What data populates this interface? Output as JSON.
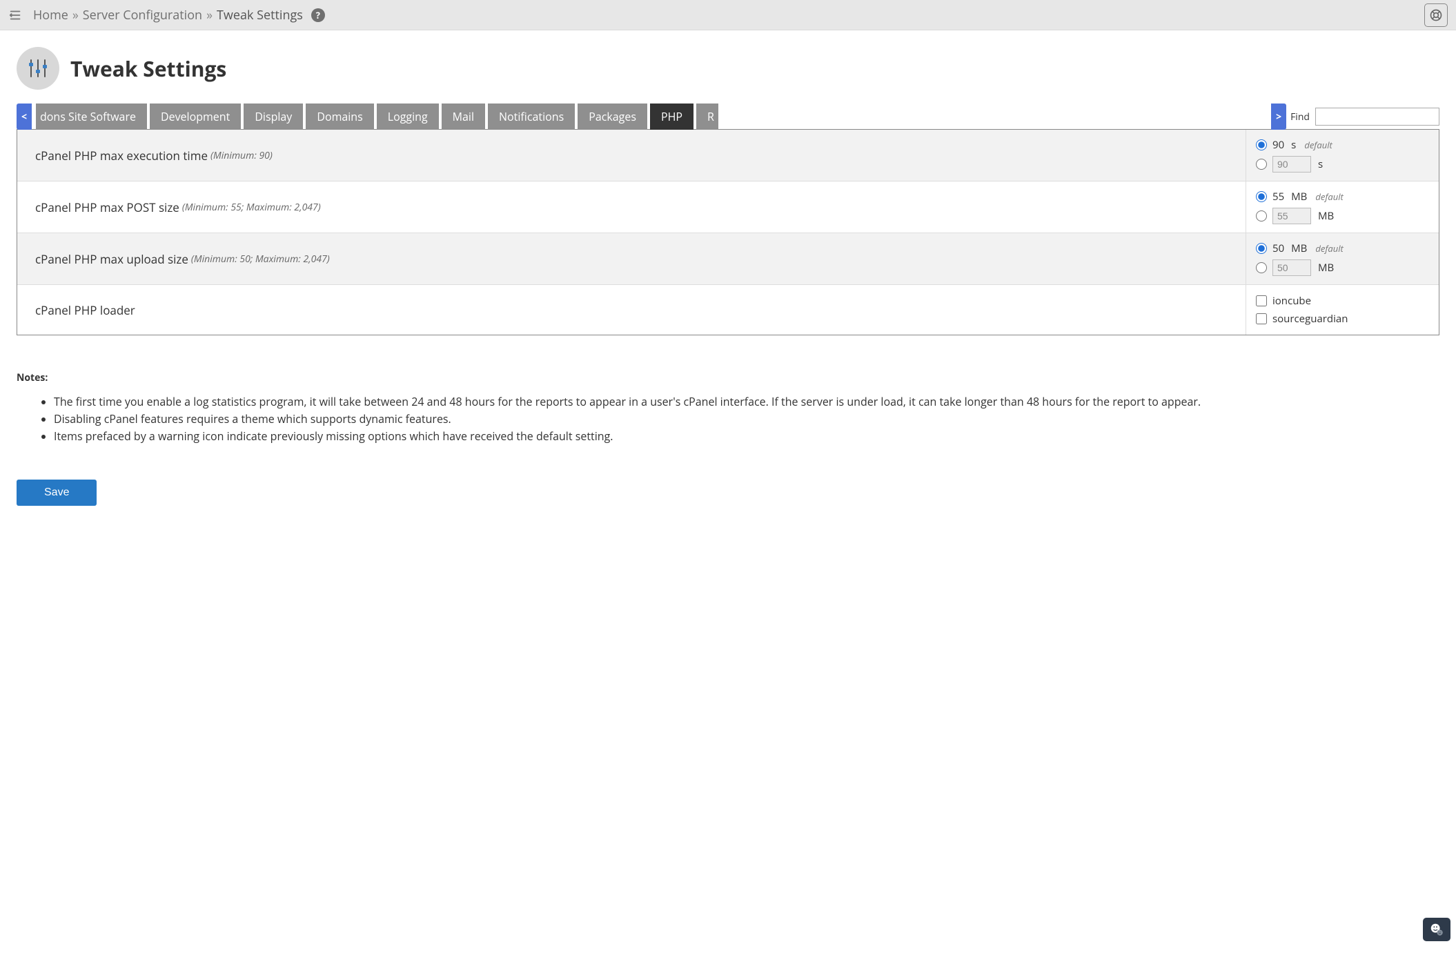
{
  "breadcrumb": {
    "home": "Home",
    "section": "Server Configuration",
    "current": "Tweak Settings"
  },
  "page": {
    "title": "Tweak Settings"
  },
  "tabs": {
    "partial_left": "dons Site Software",
    "items": [
      "Development",
      "Display",
      "Domains",
      "Logging",
      "Mail",
      "Notifications",
      "Packages",
      "PHP"
    ],
    "partial_right": "R",
    "active": "PHP"
  },
  "find": {
    "label": "Find",
    "value": ""
  },
  "settings": [
    {
      "label": "cPanel PHP max execution time",
      "hint": "(Minimum: 90)",
      "type": "radio_num",
      "default_value": "90",
      "unit": "s",
      "default_text": "default",
      "input_value": "90",
      "input_unit": "s",
      "shaded": true
    },
    {
      "label": "cPanel PHP max POST size",
      "hint": "(Minimum: 55; Maximum: 2,047)",
      "type": "radio_num",
      "default_value": "55",
      "unit": "MB",
      "default_text": "default",
      "input_value": "55",
      "input_unit": "MB",
      "shaded": false
    },
    {
      "label": "cPanel PHP max upload size",
      "hint": "(Minimum: 50; Maximum: 2,047)",
      "type": "radio_num",
      "default_value": "50",
      "unit": "MB",
      "default_text": "default",
      "input_value": "50",
      "input_unit": "MB",
      "shaded": true
    },
    {
      "label": "cPanel PHP loader",
      "hint": "",
      "type": "checkboxes",
      "options": [
        "ioncube",
        "sourceguardian"
      ],
      "shaded": false
    }
  ],
  "notes": {
    "heading": "Notes:",
    "items": [
      "The first time you enable a log statistics program, it will take between 24 and 48 hours for the reports to appear in a user's cPanel interface. If the server is under load, it can take longer than 48 hours for the report to appear.",
      "Disabling cPanel features requires a theme which supports dynamic features.",
      "Items prefaced by a warning icon indicate previously missing options which have received the default setting."
    ]
  },
  "actions": {
    "save": "Save"
  }
}
